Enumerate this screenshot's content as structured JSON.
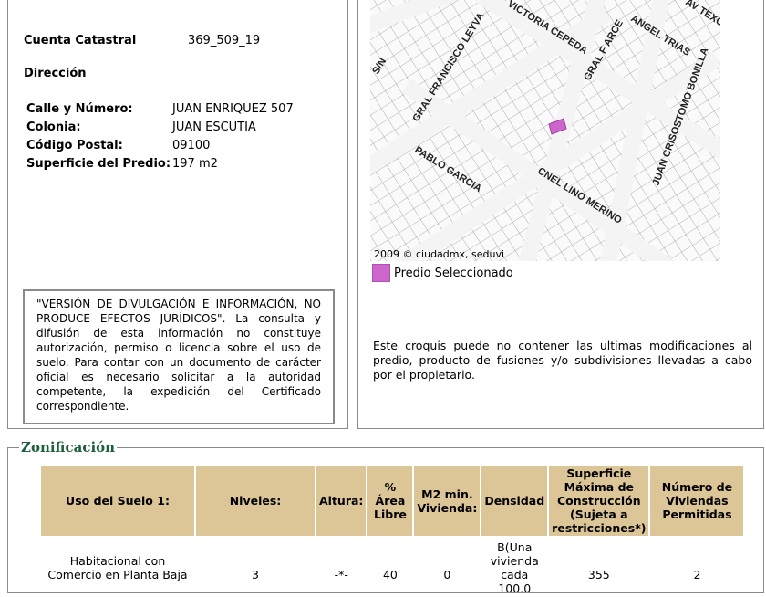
{
  "predio": {
    "cuenta_label": "Cuenta Catastral",
    "cuenta_value": "369_509_19",
    "direccion_heading": "Dirección",
    "rows": [
      {
        "label": "Calle y Número:",
        "value": "JUAN ENRIQUEZ 507"
      },
      {
        "label": "Colonia:",
        "value": "JUAN ESCUTIA"
      },
      {
        "label": "Código Postal:",
        "value": "09100"
      },
      {
        "label": "Superficie del Predio:",
        "value": "197 m2"
      }
    ]
  },
  "disclaimer": "\"VERSIÓN DE DIVULGACIÓN E INFORMACIÓN, NO PRODUCE EFECTOS JURÍDICOS\". La consulta y difusión de esta información no constituye autorización, permiso o licencia sobre el uso de suelo. Para contar con un documento de carácter oficial es necesario solicitar a la autoridad competente, la expedición del Certificado correspondiente.",
  "map": {
    "credit": "2009 © ciudadmx, seduvi",
    "legend_label": "Predio Seleccionado",
    "legend_color": "#cc66cc",
    "streets": [
      "VICTORIA CEPEDA",
      "ANGEL TRIAS",
      "AV TEXCOCO",
      "GRAL FRANCISCO LEYVA",
      "GRAL F ARCE",
      "JUAN CRISOSTOMO BONILLA",
      "PABLO GARCIA",
      "CNEL LINO MERINO",
      "S/N"
    ],
    "note": "Este croquis puede no contener las ultimas modificaciones al predio, producto de fusiones y/o subdivisiones llevadas a cabo por el propietario."
  },
  "zonificacion": {
    "title": "Zonificación",
    "header_color": "#dcc597",
    "headers": [
      "Uso del Suelo 1:",
      "Niveles:",
      "Altura:",
      "% Área Libre",
      "M2 min. Vivienda:",
      "Densidad",
      "Superficie Máxima de Construcción (Sujeta a restricciones*)",
      "Número de Viviendas Permitidas"
    ],
    "row": [
      "Habitacional con Comercio en Planta Baja",
      "3",
      "-*-",
      "40",
      "0",
      "B(Una vivienda cada 100.0",
      "355",
      "2"
    ]
  }
}
